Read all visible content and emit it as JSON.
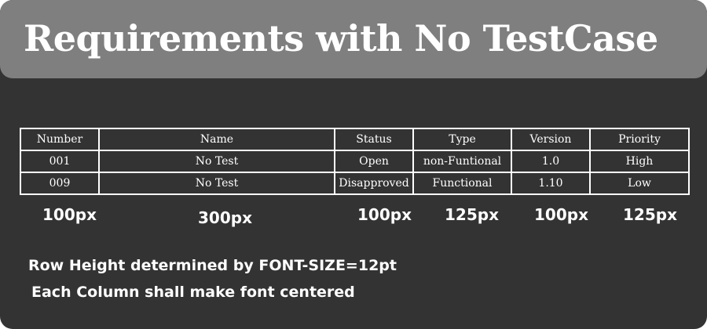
{
  "title": "Requirements with No TestCase",
  "table": {
    "headers": [
      "Number",
      "Name",
      "Status",
      "Type",
      "Version",
      "Priority"
    ],
    "rows": [
      [
        "001",
        "No Test",
        "Open",
        "non-Funtional",
        "1.0",
        "High"
      ],
      [
        "009",
        "No Test",
        "Disapproved",
        "Functional",
        "1.10",
        "Low"
      ]
    ]
  },
  "column_width_labels": [
    "100px",
    "300px",
    "100px",
    "125px",
    "100px",
    "125px"
  ],
  "notes": [
    "Row Height determined by FONT-SIZE=12pt",
    "Each Column shall make font centered"
  ],
  "colors": {
    "background": "#333333",
    "title_bar": "#7f7f7f",
    "text": "#ffffff"
  }
}
